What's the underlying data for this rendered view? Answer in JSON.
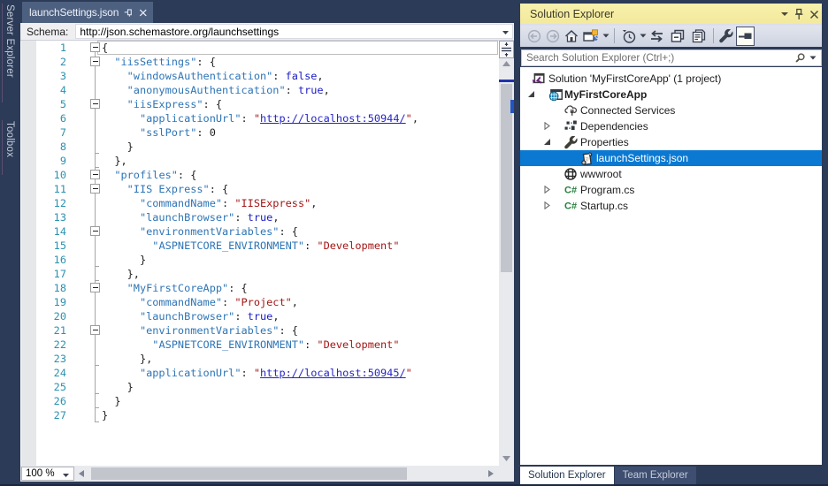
{
  "left_rail": {
    "tabs": [
      "Server Explorer",
      "Toolbox"
    ]
  },
  "document_tab": {
    "title": "launchSettings.json",
    "icons": [
      "pin-icon",
      "close-icon"
    ]
  },
  "schema_bar": {
    "label": "Schema:",
    "value": "http://json.schemastore.org/launchsettings"
  },
  "editor": {
    "zoom_level": "100 %",
    "lines": [
      {
        "n": 1,
        "fold": "box",
        "segs": [
          [
            "p",
            "{"
          ]
        ]
      },
      {
        "n": 2,
        "fold": "box",
        "segs": [
          [
            "p",
            "  "
          ],
          [
            "k",
            "\"iisSettings\""
          ],
          [
            "p",
            ": {"
          ]
        ]
      },
      {
        "n": 3,
        "fold": null,
        "segs": [
          [
            "p",
            "    "
          ],
          [
            "k",
            "\"windowsAuthentication\""
          ],
          [
            "p",
            ": "
          ],
          [
            "w",
            "false"
          ],
          [
            "p",
            ","
          ]
        ]
      },
      {
        "n": 4,
        "fold": null,
        "segs": [
          [
            "p",
            "    "
          ],
          [
            "k",
            "\"anonymousAuthentication\""
          ],
          [
            "p",
            ": "
          ],
          [
            "w",
            "true"
          ],
          [
            "p",
            ","
          ]
        ]
      },
      {
        "n": 5,
        "fold": "box",
        "segs": [
          [
            "p",
            "    "
          ],
          [
            "k",
            "\"iisExpress\""
          ],
          [
            "p",
            ": {"
          ]
        ]
      },
      {
        "n": 6,
        "fold": null,
        "segs": [
          [
            "p",
            "      "
          ],
          [
            "k",
            "\"applicationUrl\""
          ],
          [
            "p",
            ": "
          ],
          [
            "s",
            "\""
          ],
          [
            "u",
            "http://localhost:50944/"
          ],
          [
            "s",
            "\""
          ],
          [
            "p",
            ","
          ]
        ]
      },
      {
        "n": 7,
        "fold": null,
        "segs": [
          [
            "p",
            "      "
          ],
          [
            "k",
            "\"sslPort\""
          ],
          [
            "p",
            ": "
          ],
          [
            "p",
            "0"
          ]
        ]
      },
      {
        "n": 8,
        "fold": "tick",
        "segs": [
          [
            "p",
            "    }"
          ]
        ]
      },
      {
        "n": 9,
        "fold": "tick",
        "segs": [
          [
            "p",
            "  },"
          ]
        ]
      },
      {
        "n": 10,
        "fold": "box",
        "segs": [
          [
            "p",
            "  "
          ],
          [
            "k",
            "\"profiles\""
          ],
          [
            "p",
            ": {"
          ]
        ]
      },
      {
        "n": 11,
        "fold": "box",
        "segs": [
          [
            "p",
            "    "
          ],
          [
            "k",
            "\"IIS Express\""
          ],
          [
            "p",
            ": {"
          ]
        ]
      },
      {
        "n": 12,
        "fold": null,
        "segs": [
          [
            "p",
            "      "
          ],
          [
            "k",
            "\"commandName\""
          ],
          [
            "p",
            ": "
          ],
          [
            "s",
            "\"IISExpress\""
          ],
          [
            "p",
            ","
          ]
        ]
      },
      {
        "n": 13,
        "fold": null,
        "segs": [
          [
            "p",
            "      "
          ],
          [
            "k",
            "\"launchBrowser\""
          ],
          [
            "p",
            ": "
          ],
          [
            "w",
            "true"
          ],
          [
            "p",
            ","
          ]
        ]
      },
      {
        "n": 14,
        "fold": "box",
        "segs": [
          [
            "p",
            "      "
          ],
          [
            "k",
            "\"environmentVariables\""
          ],
          [
            "p",
            ": {"
          ]
        ]
      },
      {
        "n": 15,
        "fold": null,
        "segs": [
          [
            "p",
            "        "
          ],
          [
            "k",
            "\"ASPNETCORE_ENVIRONMENT\""
          ],
          [
            "p",
            ": "
          ],
          [
            "s",
            "\"Development\""
          ]
        ]
      },
      {
        "n": 16,
        "fold": "tick",
        "segs": [
          [
            "p",
            "      }"
          ]
        ]
      },
      {
        "n": 17,
        "fold": "tick",
        "segs": [
          [
            "p",
            "    },"
          ]
        ]
      },
      {
        "n": 18,
        "fold": "box",
        "segs": [
          [
            "p",
            "    "
          ],
          [
            "k",
            "\"MyFirstCoreApp\""
          ],
          [
            "p",
            ": {"
          ]
        ]
      },
      {
        "n": 19,
        "fold": null,
        "segs": [
          [
            "p",
            "      "
          ],
          [
            "k",
            "\"commandName\""
          ],
          [
            "p",
            ": "
          ],
          [
            "s",
            "\"Project\""
          ],
          [
            "p",
            ","
          ]
        ]
      },
      {
        "n": 20,
        "fold": null,
        "segs": [
          [
            "p",
            "      "
          ],
          [
            "k",
            "\"launchBrowser\""
          ],
          [
            "p",
            ": "
          ],
          [
            "w",
            "true"
          ],
          [
            "p",
            ","
          ]
        ]
      },
      {
        "n": 21,
        "fold": "box",
        "segs": [
          [
            "p",
            "      "
          ],
          [
            "k",
            "\"environmentVariables\""
          ],
          [
            "p",
            ": {"
          ]
        ]
      },
      {
        "n": 22,
        "fold": null,
        "segs": [
          [
            "p",
            "        "
          ],
          [
            "k",
            "\"ASPNETCORE_ENVIRONMENT\""
          ],
          [
            "p",
            ": "
          ],
          [
            "s",
            "\"Development\""
          ]
        ]
      },
      {
        "n": 23,
        "fold": "tick",
        "segs": [
          [
            "p",
            "      },"
          ]
        ]
      },
      {
        "n": 24,
        "fold": null,
        "segs": [
          [
            "p",
            "      "
          ],
          [
            "k",
            "\"applicationUrl\""
          ],
          [
            "p",
            ": "
          ],
          [
            "s",
            "\""
          ],
          [
            "u",
            "http://localhost:50945/"
          ],
          [
            "s",
            "\""
          ]
        ]
      },
      {
        "n": 25,
        "fold": "tick",
        "segs": [
          [
            "p",
            "    }"
          ]
        ]
      },
      {
        "n": 26,
        "fold": "tick",
        "segs": [
          [
            "p",
            "  }"
          ]
        ]
      },
      {
        "n": 27,
        "fold": "tick",
        "segs": [
          [
            "p",
            "}"
          ]
        ]
      }
    ]
  },
  "solution_explorer": {
    "title": "Solution Explorer",
    "titlebar_icons": [
      "chevron-down-icon",
      "pin-icon",
      "close-icon"
    ],
    "toolbar_icons": [
      "back",
      "forward",
      "home",
      "switch-views",
      "dropdown",
      "pending-changes-filter",
      "dropdown",
      "sync-with-active-document",
      "collapse-all",
      "show-all-files",
      "properties",
      "preview-selected-items"
    ],
    "search": {
      "placeholder": "Search Solution Explorer (Ctrl+;)"
    },
    "tree": [
      {
        "label": "Solution 'MyFirstCoreApp' (1 project)",
        "icon": "solution",
        "level": 0,
        "expander": "none"
      },
      {
        "label": "MyFirstCoreApp",
        "icon": "project",
        "level": 1,
        "expander": "expanded",
        "bold": true
      },
      {
        "label": "Connected Services",
        "icon": "connected-services",
        "level": 2,
        "expander": "none"
      },
      {
        "label": "Dependencies",
        "icon": "dependencies",
        "level": 2,
        "expander": "collapsed"
      },
      {
        "label": "Properties",
        "icon": "properties-wrench",
        "level": 2,
        "expander": "expanded"
      },
      {
        "label": "launchSettings.json",
        "icon": "json-file",
        "level": 3,
        "expander": "none",
        "selected": true
      },
      {
        "label": "wwwroot",
        "icon": "globe",
        "level": 2,
        "expander": "none"
      },
      {
        "label": "Program.cs",
        "icon": "csharp-file",
        "level": 2,
        "expander": "collapsed"
      },
      {
        "label": "Startup.cs",
        "icon": "csharp-file",
        "level": 2,
        "expander": "collapsed"
      }
    ],
    "bottom_tabs": [
      {
        "label": "Solution Explorer",
        "active": true
      },
      {
        "label": "Team Explorer",
        "active": false
      }
    ]
  }
}
